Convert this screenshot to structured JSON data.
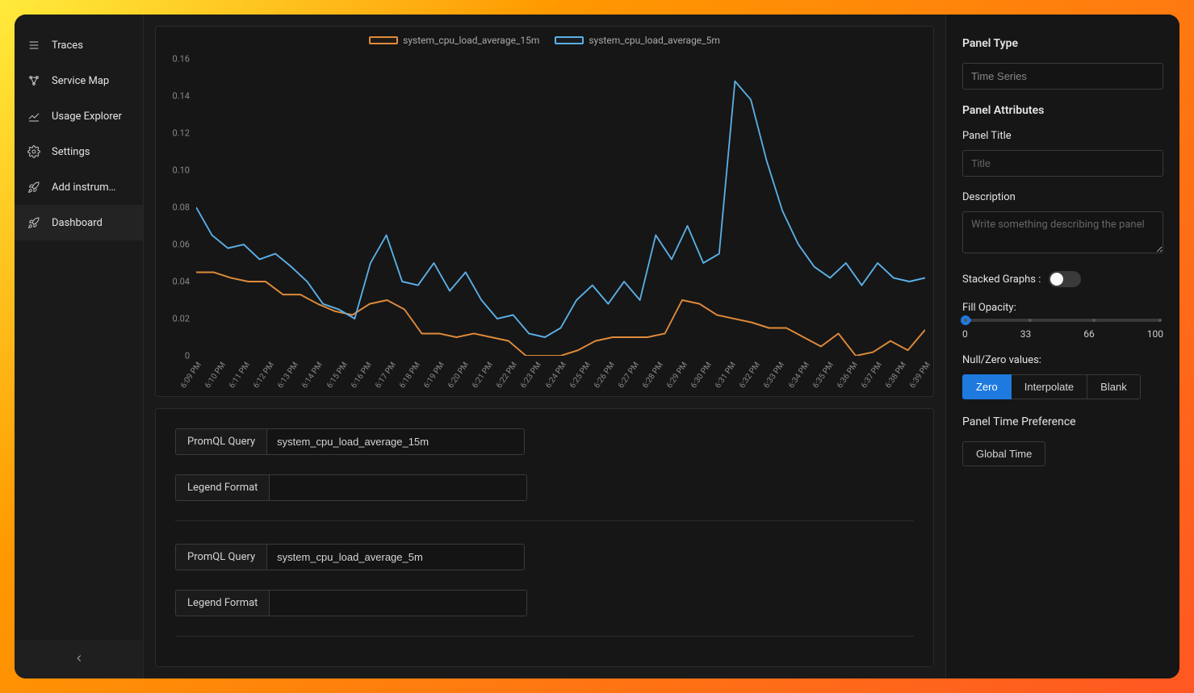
{
  "sidebar": {
    "items": [
      {
        "label": "Traces",
        "icon": "list"
      },
      {
        "label": "Service Map",
        "icon": "network"
      },
      {
        "label": "Usage Explorer",
        "icon": "chart"
      },
      {
        "label": "Settings",
        "icon": "gear"
      },
      {
        "label": "Add instrum…",
        "icon": "rocket"
      },
      {
        "label": "Dashboard",
        "icon": "rocket"
      }
    ],
    "active_index": 5
  },
  "queries": [
    {
      "label": "PromQL Query",
      "value": "system_cpu_load_average_15m",
      "legend_label": "Legend Format",
      "legend_value": ""
    },
    {
      "label": "PromQL Query",
      "value": "system_cpu_load_average_5m",
      "legend_label": "Legend Format",
      "legend_value": ""
    }
  ],
  "right_panel": {
    "panel_type_heading": "Panel Type",
    "panel_type_value": "Time Series",
    "panel_attributes_heading": "Panel Attributes",
    "panel_title_label": "Panel Title",
    "panel_title_placeholder": "Title",
    "description_label": "Description",
    "description_placeholder": "Write something describing the panel",
    "stacked_label": "Stacked Graphs :",
    "stacked_on": false,
    "fill_opacity_label": "Fill Opacity:",
    "fill_opacity_marks": [
      "0",
      "33",
      "66",
      "100"
    ],
    "null_zero_label": "Null/Zero values:",
    "null_zero_options": [
      "Zero",
      "Interpolate",
      "Blank"
    ],
    "null_zero_active": "Zero",
    "time_pref_label": "Panel Time Preference",
    "time_pref_button": "Global Time"
  },
  "chart_data": {
    "type": "line",
    "title": "",
    "xlabel": "",
    "ylabel": "",
    "ylim": [
      0,
      0.16
    ],
    "y_ticks": [
      0,
      0.02,
      0.04,
      0.06,
      0.08,
      0.1,
      0.12,
      0.14,
      0.16
    ],
    "categories": [
      "6:09 PM",
      "6:10 PM",
      "6:11 PM",
      "6:12 PM",
      "6:13 PM",
      "6:14 PM",
      "6:15 PM",
      "6:16 PM",
      "6:17 PM",
      "6:18 PM",
      "6:19 PM",
      "6:20 PM",
      "6:21 PM",
      "6:22 PM",
      "6:23 PM",
      "6:24 PM",
      "6:25 PM",
      "6:26 PM",
      "6:27 PM",
      "6:28 PM",
      "6:29 PM",
      "6:30 PM",
      "6:31 PM",
      "6:32 PM",
      "6:33 PM",
      "6:34 PM",
      "6:35 PM",
      "6:36 PM",
      "6:37 PM",
      "6:38 PM",
      "6:39 PM"
    ],
    "series": [
      {
        "name": "system_cpu_load_average_15m",
        "color": "#e08b3a",
        "values": [
          0.045,
          0.045,
          0.042,
          0.04,
          0.04,
          0.033,
          0.033,
          0.028,
          0.024,
          0.022,
          0.028,
          0.03,
          0.025,
          0.012,
          0.012,
          0.01,
          0.012,
          0.01,
          0.008,
          0.0,
          0.0,
          0.0,
          0.003,
          0.008,
          0.01,
          0.01,
          0.01,
          0.012,
          0.03,
          0.028,
          0.022,
          0.02,
          0.018,
          0.015,
          0.015,
          0.01,
          0.005,
          0.012,
          0.0,
          0.002,
          0.008,
          0.003,
          0.014
        ]
      },
      {
        "name": "system_cpu_load_average_5m",
        "color": "#5bb0e8",
        "values": [
          0.08,
          0.065,
          0.058,
          0.06,
          0.052,
          0.055,
          0.048,
          0.04,
          0.028,
          0.025,
          0.02,
          0.05,
          0.065,
          0.04,
          0.038,
          0.05,
          0.035,
          0.045,
          0.03,
          0.02,
          0.022,
          0.012,
          0.01,
          0.015,
          0.03,
          0.038,
          0.028,
          0.04,
          0.03,
          0.065,
          0.052,
          0.07,
          0.05,
          0.055,
          0.148,
          0.138,
          0.105,
          0.078,
          0.06,
          0.048,
          0.042,
          0.05,
          0.038,
          0.05,
          0.042,
          0.04,
          0.042
        ]
      }
    ],
    "legend": [
      "system_cpu_load_average_15m",
      "system_cpu_load_average_5m"
    ],
    "legend_position": "top"
  }
}
